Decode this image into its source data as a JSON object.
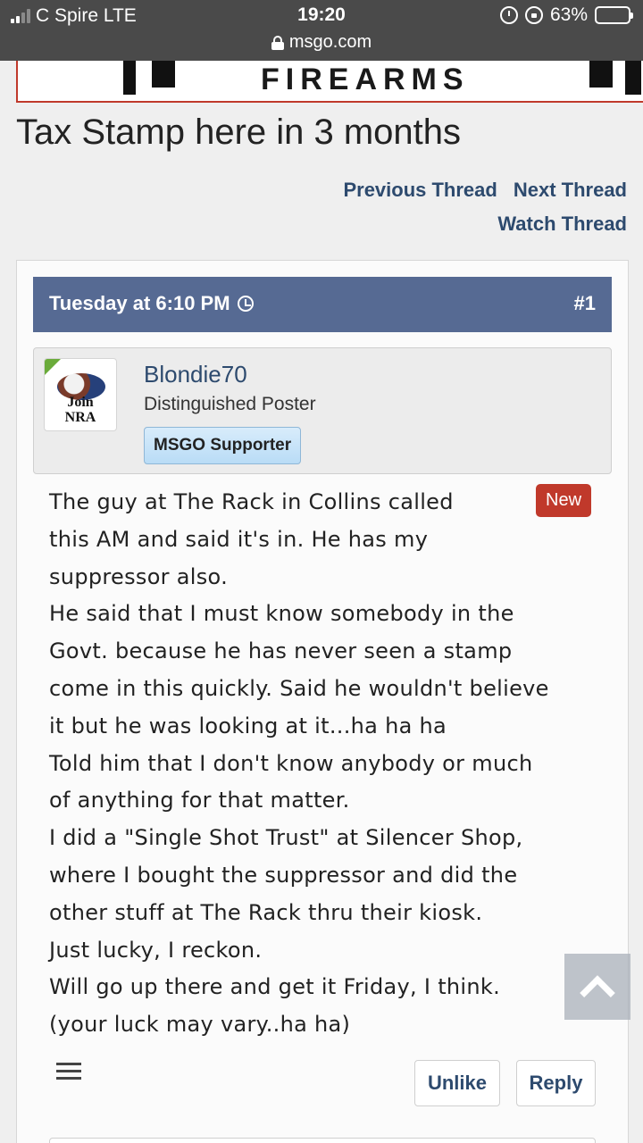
{
  "status_bar": {
    "carrier": "C Spire  LTE",
    "time": "19:20",
    "url": "msgo.com",
    "battery": "63%",
    "battery_level": 0.63,
    "icons": [
      "signal-icon",
      "lock-icon",
      "alarm-icon",
      "rotation-lock-icon",
      "battery-icon"
    ]
  },
  "banner": {
    "text": "FIREARMS"
  },
  "thread": {
    "title": "Tax Stamp here in 3 months",
    "prev_label": "Previous Thread",
    "next_label": "Next Thread",
    "watch_label": "Watch Thread"
  },
  "post": {
    "date": "Tuesday at 6:10 PM",
    "number": "#1",
    "author": "Blondie70",
    "author_title": "Distinguished Poster",
    "author_badge": "MSGO Supporter",
    "avatar_text_1": "Join",
    "avatar_text_2": "NRA",
    "new_badge": "New",
    "lines": [
      "The guy at The Rack in Collins called",
      "this AM and said it's in. He has my",
      "suppressor also.",
      "He said that I must know somebody in the",
      "Govt. because he has never seen a stamp",
      "come in this quickly. Said he wouldn't believe",
      "it but he was looking at it...ha ha ha",
      "Told him that I don't know anybody or much",
      "of anything for that matter.",
      "I did a \"Single Shot Trust\" at Silencer Shop,",
      "where I bought the suppressor and did the",
      "other stuff at The Rack thru their kiosk.",
      "Just lucky, I reckon.",
      "Will go up there and get it Friday, I think.",
      "(your luck may vary..ha ha)"
    ],
    "unlike_label": "Unlike",
    "reply_label": "Reply"
  },
  "colors": {
    "header_bg": "#566a93",
    "link": "#2d4a6e",
    "new_badge": "#c0392b",
    "page_bg": "#efefef"
  }
}
